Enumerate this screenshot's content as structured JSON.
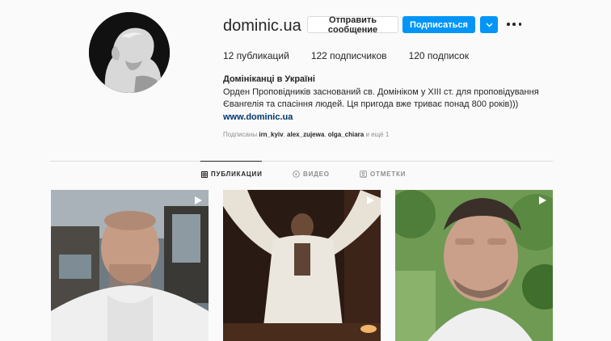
{
  "profile": {
    "username": "dominic.ua",
    "message_button": "Отправить сообщение",
    "follow_button": "Подписаться",
    "stats": {
      "posts": "12 публикаций",
      "followers": "122 подписчиков",
      "following": "120 подписок"
    },
    "full_name": "Домініканці в Україні",
    "bio_line1": "Орден Проповідників заснований св. Домініком у XIII ст. для проповідування",
    "bio_line2": "Євангелія та спасіння людей. Ця пригода вже триває понад 800 років)))",
    "website": "www.dominic.ua",
    "followed_by": {
      "prefix": "Подписаны ",
      "user1": "irn_kyiv",
      "sep1": ", ",
      "user2": "alex_zujewa",
      "sep2": ", ",
      "user3": "olga_chiara",
      "suffix": " и ещё 1"
    }
  },
  "tabs": [
    {
      "label": "ПУБЛИКАЦИИ",
      "icon": "grid-icon",
      "active": true
    },
    {
      "label": "ВИДЕО",
      "icon": "video-icon",
      "active": false
    },
    {
      "label": "ОТМЕТКИ",
      "icon": "tagged-icon",
      "active": false
    }
  ],
  "posts": [
    {
      "type": "video",
      "subject": "man-in-white-habit-by-window"
    },
    {
      "type": "video",
      "subject": "figure-with-raised-arms"
    },
    {
      "type": "video",
      "subject": "man-selfie-in-garden"
    }
  ],
  "colors": {
    "accent": "#0095f6",
    "link": "#00376b",
    "muted": "#8e8e8e",
    "border": "#dbdbdb"
  }
}
